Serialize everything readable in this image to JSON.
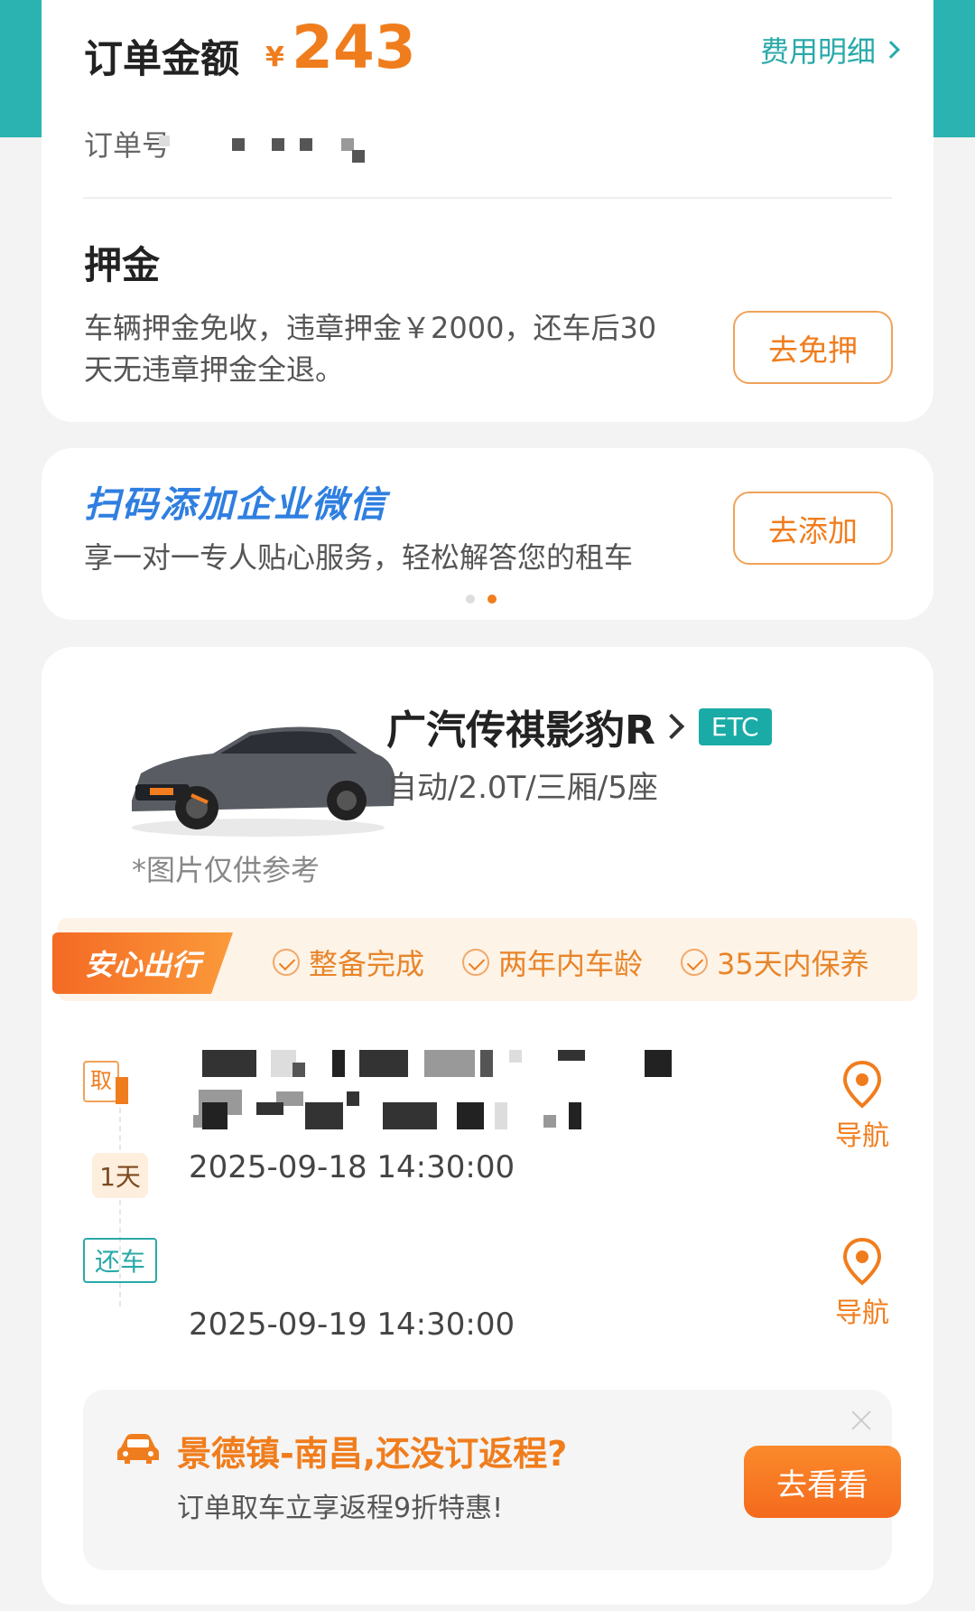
{
  "colors": {
    "teal": "#2bb3b1",
    "orange": "#f07d1d",
    "blue": "#2f7fe0"
  },
  "order": {
    "title": "订单金额",
    "currency": "¥",
    "amount": "243",
    "fee_detail_label": "费用明细",
    "order_no_label": "订单号"
  },
  "deposit": {
    "title": "押金",
    "description": "车辆押金免收，违章押金￥2000，还车后30天无违章押金全退。",
    "button_label": "去免押"
  },
  "wechat": {
    "title": "扫码添加企业微信",
    "subtitle": "享一对一专人贴心服务，轻松解答您的租车",
    "button_label": "去添加",
    "carousel_active_index": 1
  },
  "car": {
    "name": "广汽传祺影豹R",
    "etc_badge": "ETC",
    "spec": "自动/2.0T/三厢/5座",
    "image_note": "*图片仅供参考"
  },
  "safe_trip": {
    "tag": "安心出行",
    "items": [
      "整备完成",
      "两年内车龄",
      "35天内保养"
    ]
  },
  "trip": {
    "pick_tag": "取",
    "duration_badge": "1天",
    "pick_time": "2025-09-18 14:30:00",
    "return_tag": "还车",
    "return_time": "2025-09-19 14:30:00",
    "nav_label": "导航"
  },
  "promo": {
    "title": "景德镇-南昌,还没订返程?",
    "subtitle": "订单取车立享返程9折特惠!",
    "button_label": "去看看"
  }
}
